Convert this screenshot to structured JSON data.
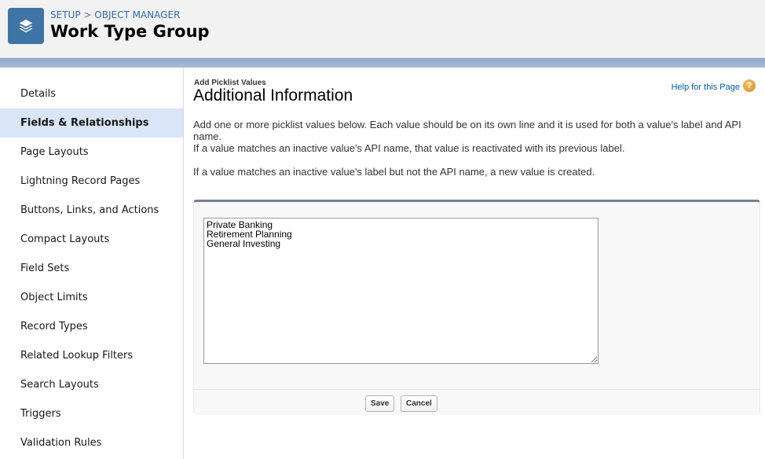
{
  "header": {
    "breadcrumb": {
      "setup": "SETUP",
      "separator": ">",
      "object_manager": "OBJECT MANAGER"
    },
    "title": "Work Type Group",
    "icon": "layers-icon",
    "icon_color": "#3f74a6"
  },
  "sidebar": {
    "items": [
      {
        "label": "Details",
        "active": false
      },
      {
        "label": "Fields & Relationships",
        "active": true
      },
      {
        "label": "Page Layouts",
        "active": false
      },
      {
        "label": "Lightning Record Pages",
        "active": false
      },
      {
        "label": "Buttons, Links, and Actions",
        "active": false
      },
      {
        "label": "Compact Layouts",
        "active": false
      },
      {
        "label": "Field Sets",
        "active": false
      },
      {
        "label": "Object Limits",
        "active": false
      },
      {
        "label": "Record Types",
        "active": false
      },
      {
        "label": "Related Lookup Filters",
        "active": false
      },
      {
        "label": "Search Layouts",
        "active": false
      },
      {
        "label": "Triggers",
        "active": false
      },
      {
        "label": "Validation Rules",
        "active": false
      }
    ]
  },
  "main": {
    "subtitle": "Add Picklist Values",
    "title": "Additional Information",
    "help_link": "Help for this Page",
    "help_icon": "question-icon",
    "descriptions": [
      "Add one or more picklist values below. Each value should be on its own line and it is used for both a value's label and API name.",
      "If a value matches an inactive value's API name, that value is reactivated with its previous label.",
      "If a value matches an inactive value's label but not the API name, a new value is created."
    ],
    "values_text": "Private Banking\nRetirement Planning\nGeneral Investing",
    "save_label": "Save",
    "cancel_label": "Cancel"
  }
}
